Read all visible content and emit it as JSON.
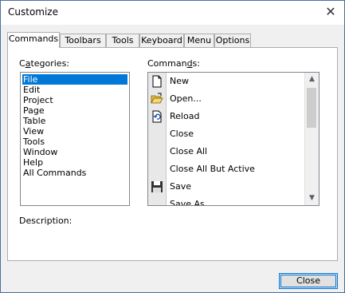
{
  "window": {
    "title": "Customize",
    "close_glyph": "✕"
  },
  "tabs": [
    {
      "label": "Commands",
      "active": true
    },
    {
      "label": "Toolbars"
    },
    {
      "label": "Tools"
    },
    {
      "label": "Keyboard"
    },
    {
      "label": "Menu"
    },
    {
      "label": "Options"
    }
  ],
  "categories": {
    "label_prefix": "C",
    "label_underlined": "a",
    "label_rest": "tegories:",
    "items": [
      "File",
      "Edit",
      "Project",
      "Page",
      "Table",
      "View",
      "Tools",
      "Window",
      "Help",
      "All Commands"
    ],
    "selected": "File"
  },
  "commands": {
    "label_prefix": "Comman",
    "label_underlined": "d",
    "label_rest": "s:",
    "items": [
      {
        "label": "New",
        "icon": "new-document-icon"
      },
      {
        "label": "Open...",
        "icon": "open-folder-icon"
      },
      {
        "label": "Reload",
        "icon": "reload-icon"
      },
      {
        "label": "Close",
        "icon": ""
      },
      {
        "label": "Close All",
        "icon": ""
      },
      {
        "label": "Close All But Active",
        "icon": ""
      },
      {
        "label": "Save",
        "icon": "save-disk-icon"
      },
      {
        "label": "Save As...",
        "icon": ""
      }
    ]
  },
  "description_label": "Description:",
  "close_button": "Close",
  "colors": {
    "selection": "#0078d7",
    "accent_border": "#0078d7"
  }
}
